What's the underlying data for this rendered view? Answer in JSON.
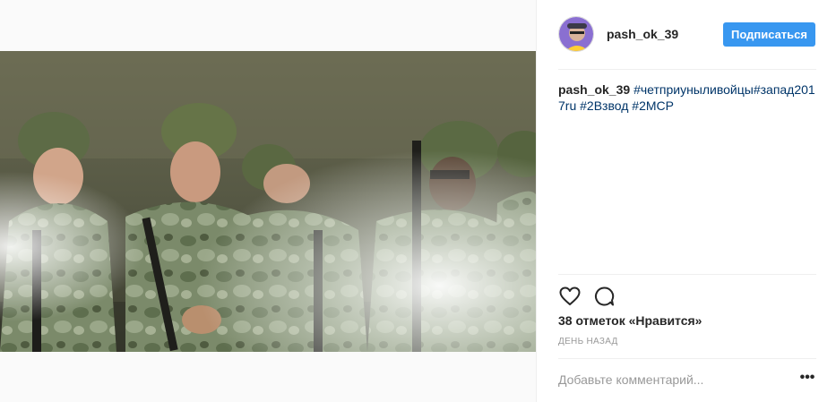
{
  "post": {
    "photo_alt": "",
    "header": {
      "username": "pash_ok_39",
      "follow_label": "Подписаться",
      "follow_color": "#3897f0"
    },
    "caption": {
      "username": "pash_ok_39",
      "hashtags": [
        "#четприуныливойцы",
        "#запад2017ru",
        "#2Взвод",
        "#2МСР"
      ],
      "hashtag_color": "#003569"
    },
    "actions": {
      "like_icon": "heart-icon",
      "comment_icon": "comment-bubble-icon"
    },
    "likes_text": "38 отметок «Нравится»",
    "time_text": "ДЕНЬ НАЗАД",
    "comment_box": {
      "placeholder": "Добавьте комментарий...",
      "more_icon": "more-options-icon"
    }
  }
}
